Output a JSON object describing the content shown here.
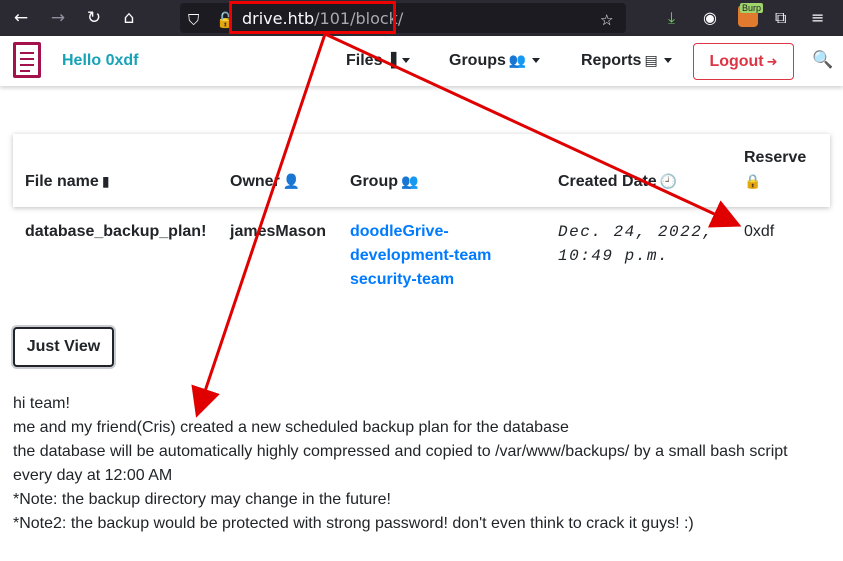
{
  "browser": {
    "url_host": "drive.htb",
    "url_path": "/101/block/",
    "burp_badge": "Burp"
  },
  "nav": {
    "greeting": "Hello 0xdf",
    "menu_files": "Files",
    "menu_groups": "Groups",
    "menu_reports": "Reports",
    "logout_label": "Logout"
  },
  "table": {
    "headers": {
      "file_name": "File name",
      "owner": "Owner",
      "group": "Group",
      "created_date": "Created Date",
      "reserve": "Reserve"
    },
    "row": {
      "file_name": "database_backup_plan!",
      "owner": "jamesMason",
      "groups": [
        "doodleGrive-development-team",
        "security-team"
      ],
      "created_line1": "Dec. 24, 2022,",
      "created_line2": "10:49 p.m.",
      "reserve": "0xdf"
    }
  },
  "actions": {
    "just_view": "Just View"
  },
  "message": {
    "lines": [
      "hi team!",
      "me and my friend(Cris) created a new scheduled backup plan for the database",
      "the database will be automatically highly compressed and copied to /var/www/backups/ by a small bash script",
      "every day at 12:00 AM",
      "*Note: the backup directory may change in the future!",
      "*Note2: the backup would be protected with strong password! don't even think to crack it guys! :)"
    ]
  },
  "colors": {
    "annotation": "#e00000",
    "brand_logo": "#a3124d",
    "greeting": "#17a2b8",
    "group_link": "#007bff",
    "logout": "#dc3545"
  }
}
